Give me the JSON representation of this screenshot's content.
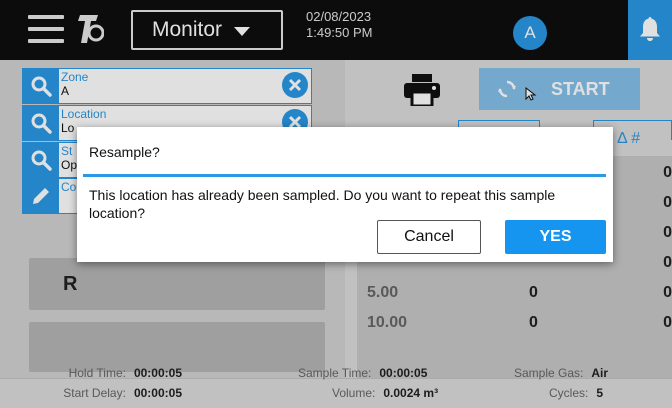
{
  "header": {
    "mode_label": "Monitor",
    "date": "02/08/2023",
    "time": "1:49:50 PM",
    "avatar_initial": "A"
  },
  "fields": [
    {
      "label": "Zone",
      "value": "A"
    },
    {
      "label": "Location",
      "value": "Lo"
    },
    {
      "label": "St",
      "value": "Op"
    },
    {
      "label": "Co",
      "value": ""
    }
  ],
  "left_buttons": {
    "r_label": "R"
  },
  "right": {
    "start_label": "START",
    "delta_header": "Δ #",
    "rows": [
      {
        "c1": "",
        "c2": "",
        "c3": "0"
      },
      {
        "c1": "",
        "c2": "",
        "c3": "0"
      },
      {
        "c1": "",
        "c2": "",
        "c3": "0"
      },
      {
        "c1": "",
        "c2": "",
        "c3": "0"
      },
      {
        "c1": "5.00",
        "c2": "0",
        "c3": "0"
      },
      {
        "c1": "10.00",
        "c2": "0",
        "c3": "0"
      }
    ]
  },
  "bottom": {
    "hold_time_label": "Hold Time:",
    "hold_time_value": "00:00:05",
    "start_delay_label": "Start Delay:",
    "start_delay_value": "00:00:05",
    "sample_time_label": "Sample Time:",
    "sample_time_value": "00:00:05",
    "volume_label": "Volume:",
    "volume_value": "0.0024 m³",
    "sample_gas_label": "Sample Gas:",
    "sample_gas_value": "Air",
    "cycles_label": "Cycles:",
    "cycles_value": "5"
  },
  "dialog": {
    "title": "Resample?",
    "message": "This location has already been sampled. Do you want to repeat this sample location?",
    "cancel_label": "Cancel",
    "yes_label": "YES"
  },
  "colors": {
    "accent": "#2a98e5",
    "topbar": "#0e0e0e",
    "start_disabled": "#84c0ea"
  },
  "icons": [
    "menu-icon",
    "tsi-logo",
    "chevron-down-icon",
    "bell-icon",
    "search-icon",
    "close-icon",
    "pencil-icon",
    "printer-icon",
    "sync-icon"
  ]
}
